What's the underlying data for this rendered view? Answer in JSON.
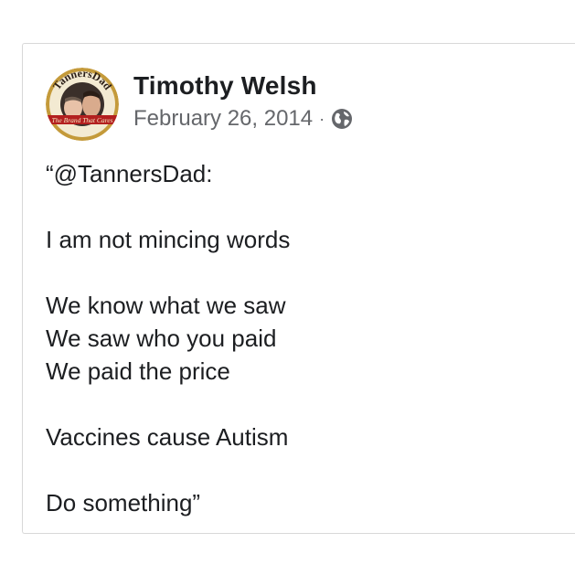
{
  "post": {
    "author_name": "Timothy Welsh",
    "date": "February 26, 2014",
    "separator": "·",
    "privacy_icon": "globe-icon",
    "avatar": {
      "arc_text": "TannersDad",
      "banner_text": "The Brand That Cares"
    },
    "lines": {
      "l1": "“@TannersDad:",
      "l2": "I am not mincing words",
      "l3": "We know what we saw",
      "l4": "We saw who you paid",
      "l5": "We paid the price",
      "l6": "Vaccines cause Autism",
      "l7": "Do something”"
    }
  },
  "colors": {
    "text": "#1c1e21",
    "secondary_text": "#65676b",
    "card_border": "#d8d8d8",
    "avatar_ring": "#c49a3a",
    "avatar_banner": "#b31f1f"
  }
}
